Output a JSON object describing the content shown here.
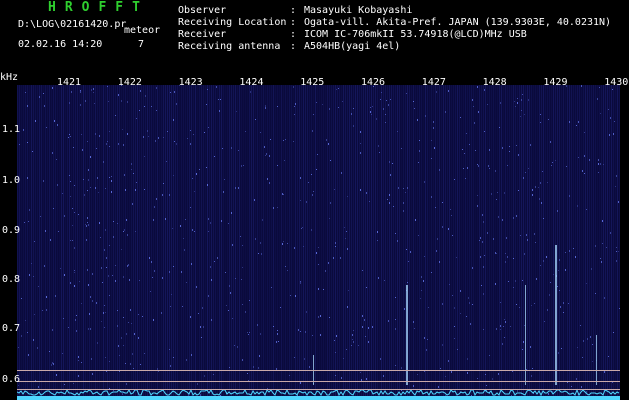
{
  "header": {
    "title": "HROFFT",
    "file": "D:\\LOG\\02161420.pr",
    "meteor_label": "meteor",
    "date_time": "02.02.16 14:20",
    "meteor_count": "7",
    "meta": [
      {
        "label": "Observer",
        "value": "Masayuki Kobayashi"
      },
      {
        "label": "Receiving Location",
        "value": "Ogata-vill. Akita-Pref. JAPAN (139.9303E, 40.0231N)"
      },
      {
        "label": "Receiver",
        "value": "ICOM IC-706mkII 53.74918(@LCD)MHz USB"
      },
      {
        "label": "Receiving antenna",
        "value": "A504HB(yagi 4el)"
      }
    ]
  },
  "axis": {
    "unit": "kHz",
    "x_ticks": [
      "1421",
      "1422",
      "1423",
      "1424",
      "1425",
      "1426",
      "1427",
      "1428",
      "1429",
      "1430"
    ],
    "y_ticks": [
      "1.1",
      "1.0",
      "0.9",
      "0.8",
      "0.7",
      "0.6"
    ]
  },
  "colors": {
    "background": "#0a0a3c",
    "spectrum": "#4fd6ff",
    "title": "#2fcf2f",
    "signal": "#a8d8ff"
  }
}
